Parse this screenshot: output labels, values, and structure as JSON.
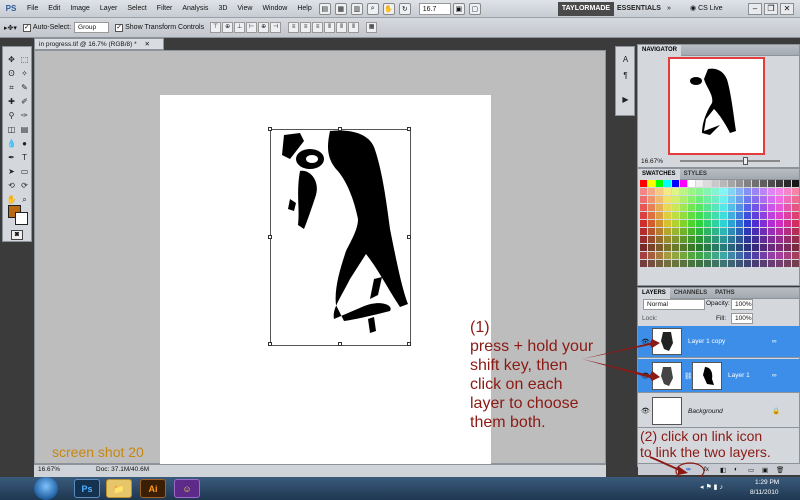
{
  "app": {
    "logo": "PS",
    "menu": [
      "File",
      "Edit",
      "Image",
      "Layer",
      "Select",
      "Filter",
      "Analysis",
      "3D",
      "View",
      "Window",
      "Help"
    ],
    "zoom": "16.7",
    "workspaces": [
      "TAYLORMADE",
      "ESSENTIALS"
    ],
    "cs_live": "CS Live"
  },
  "options_bar": {
    "auto_select_label": "Auto-Select:",
    "auto_select_value": "Group",
    "show_transform_label": "Show Transform Controls"
  },
  "document": {
    "tab_title": "in progress.tif @ 16.7% (RGB/8) *",
    "status_zoom": "16.67%",
    "status_doc": "Doc: 37.1M/40.6M"
  },
  "panels": {
    "navigator": {
      "title": "NAVIGATOR",
      "zoom": "16.67%"
    },
    "swatches": {
      "tabs": [
        "SWATCHES",
        "STYLES"
      ]
    },
    "layers": {
      "tabs": [
        "LAYERS",
        "CHANNELS",
        "PATHS"
      ],
      "blend_mode": "Normal",
      "opacity_label": "Opacity:",
      "opacity_value": "100%",
      "lock_label": "Lock:",
      "fill_label": "Fill:",
      "fill_value": "100%",
      "items": [
        {
          "name": "Layer 1 copy",
          "selected": true
        },
        {
          "name": "Layer 1",
          "selected": true
        },
        {
          "name": "Background",
          "selected": false
        }
      ]
    }
  },
  "annotations": {
    "step1_lines": [
      "(1)",
      "press + hold your",
      "shift key, then",
      "click on each",
      "layer to choose",
      "them both."
    ],
    "step2_lines": [
      "(2) click on link icon",
      "to link the two layers."
    ],
    "label": "screen shot 20"
  },
  "taskbar": {
    "apps": [
      "Ps",
      "Ai"
    ],
    "time": "1:29 PM",
    "date": "8/11/2010"
  },
  "colors": {
    "foreground": "#b96a10",
    "background": "#ffffff",
    "selection": "#3d8ee8",
    "annotation": "#8b1a14",
    "label": "#c8860e"
  }
}
